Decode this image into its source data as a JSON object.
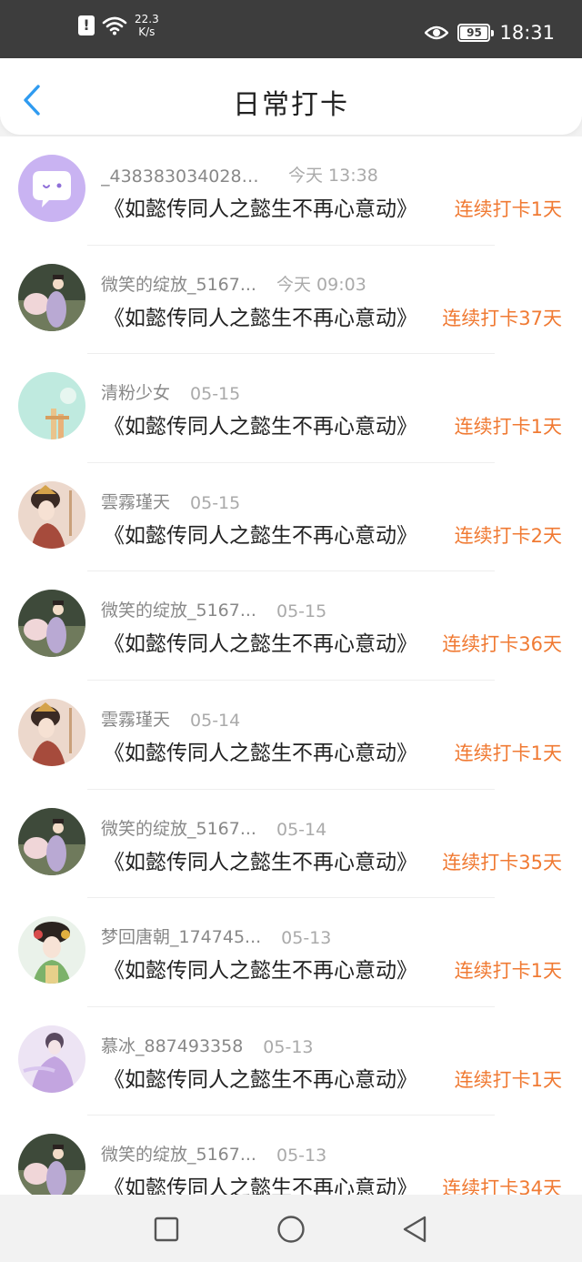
{
  "status_bar": {
    "network_speed": "22.3",
    "network_unit": "K/s",
    "battery": "95",
    "time": "18:31"
  },
  "header": {
    "title": "日常打卡"
  },
  "items": [
    {
      "username": "_4383830340289...",
      "time": "今天 13:38",
      "book": "《如懿传同人之懿生不再心意动》",
      "streak": "连续打卡1天",
      "avatar": "chat-bubble"
    },
    {
      "username": "微笑的绽放_5167...",
      "time": "今天 09:03",
      "book": "《如懿传同人之懿生不再心意动》",
      "streak": "连续打卡37天",
      "avatar": "figure-a"
    },
    {
      "username": "清粉少女",
      "time": "05-15",
      "book": "《如懿传同人之懿生不再心意动》",
      "streak": "连续打卡1天",
      "avatar": "figure-b"
    },
    {
      "username": "雲霧瑾天",
      "time": "05-15",
      "book": "《如懿传同人之懿生不再心意动》",
      "streak": "连续打卡2天",
      "avatar": "figure-c"
    },
    {
      "username": "微笑的绽放_5167...",
      "time": "05-15",
      "book": "《如懿传同人之懿生不再心意动》",
      "streak": "连续打卡36天",
      "avatar": "figure-a"
    },
    {
      "username": "雲霧瑾天",
      "time": "05-14",
      "book": "《如懿传同人之懿生不再心意动》",
      "streak": "连续打卡1天",
      "avatar": "figure-c"
    },
    {
      "username": "微笑的绽放_5167...",
      "time": "05-14",
      "book": "《如懿传同人之懿生不再心意动》",
      "streak": "连续打卡35天",
      "avatar": "figure-a"
    },
    {
      "username": "梦回唐朝_174745...",
      "time": "05-13",
      "book": "《如懿传同人之懿生不再心意动》",
      "streak": "连续打卡1天",
      "avatar": "figure-d"
    },
    {
      "username": "慕冰_887493358",
      "time": "05-13",
      "book": "《如懿传同人之懿生不再心意动》",
      "streak": "连续打卡1天",
      "avatar": "figure-e"
    },
    {
      "username": "微笑的绽放_5167...",
      "time": "05-13",
      "book": "《如懿传同人之懿生不再心意动》",
      "streak": "连续打卡34天",
      "avatar": "figure-a"
    }
  ],
  "colors": {
    "accent_back": "#2f9bf0",
    "streak": "#f07a33"
  },
  "nav": {
    "icons": [
      "square-icon",
      "circle-icon",
      "triangle-back-icon"
    ]
  }
}
